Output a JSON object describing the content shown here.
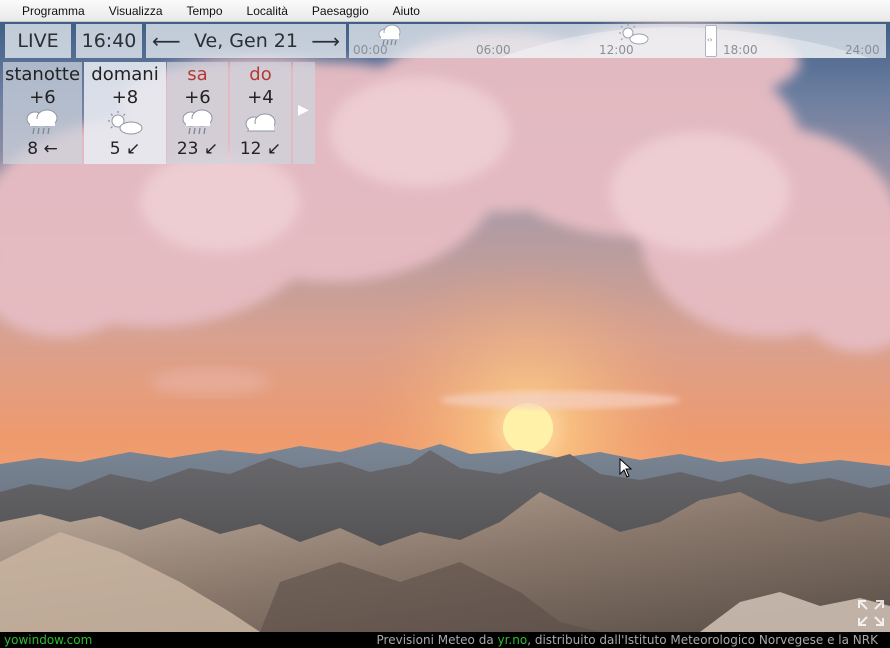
{
  "menu": [
    "Programma",
    "Visualizza",
    "Tempo",
    "Località",
    "Paesaggio",
    "Aiuto"
  ],
  "timeline": {
    "live_label": "LIVE",
    "time": "16:40",
    "date": "Ve, Gen 21",
    "prev_arrow": "⟵",
    "next_arrow": "⟶",
    "ticks": [
      "00:00",
      "06:00",
      "12:00",
      "18:00",
      "24:00"
    ],
    "icons": [
      "rain-cloud-icon",
      "sun-cloud-icon"
    ]
  },
  "forecast": [
    {
      "day": "stanotte",
      "temp": "+6",
      "icon": "rain-cloud-icon",
      "wind": "8 ←",
      "weekend": false
    },
    {
      "day": "domani",
      "temp": "+8",
      "icon": "sun-cloud-icon",
      "wind": "5 ↙",
      "weekend": false
    },
    {
      "day": "sa",
      "temp": "+6",
      "icon": "rain-cloud-icon",
      "wind": "23 ↙",
      "weekend": true
    },
    {
      "day": "do",
      "temp": "+4",
      "icon": "cloud-icon",
      "wind": "12 ↙",
      "weekend": true
    }
  ],
  "forecast_next_arrow": "▶",
  "status": {
    "brand": "yowindow.com",
    "credit_prefix": "Previsioni Meteo da ",
    "credit_source": "yr.no",
    "credit_suffix": ", distribuito dall'Istituto Meteorologico Norvegese e la NRK"
  },
  "colors": {
    "weekend": "#b23a34",
    "brand": "#2fbf2f",
    "sun": "#fff4b0"
  }
}
